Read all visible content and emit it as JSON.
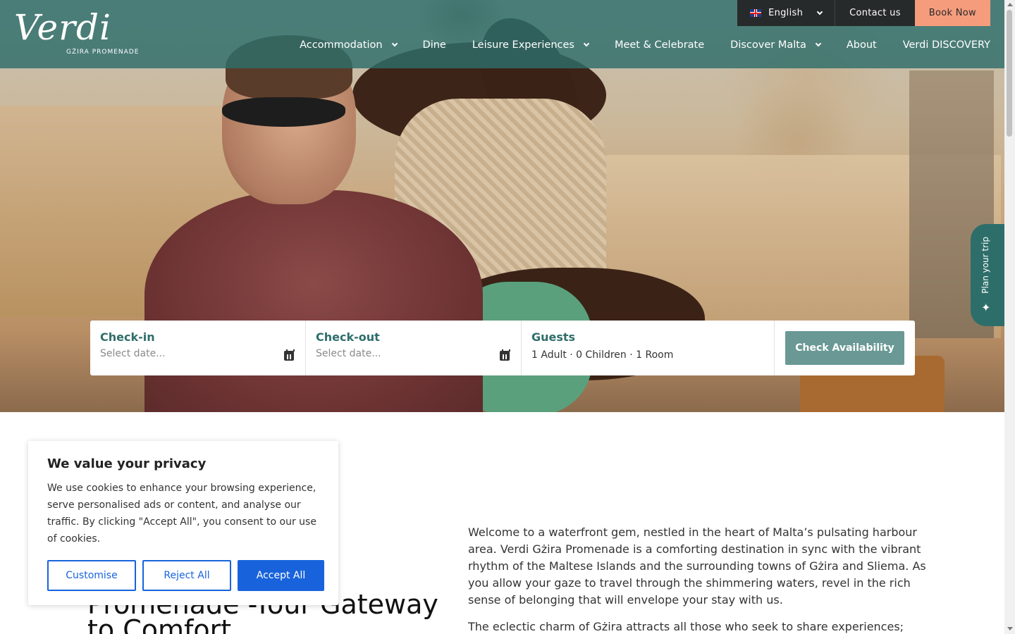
{
  "header": {
    "logo_text": "Verdi",
    "logo_subtitle": "GŻIRA PROMENADE",
    "topbar": {
      "language": "English",
      "contact": "Contact us",
      "book": "Book Now"
    },
    "nav": [
      {
        "label": "Accommodation",
        "has_dropdown": true
      },
      {
        "label": "Dine",
        "has_dropdown": false
      },
      {
        "label": "Leisure Experiences",
        "has_dropdown": true
      },
      {
        "label": "Meet & Celebrate",
        "has_dropdown": false
      },
      {
        "label": "Discover Malta",
        "has_dropdown": true
      },
      {
        "label": "About",
        "has_dropdown": false
      },
      {
        "label": "Verdi DISCOVERY",
        "has_dropdown": false
      }
    ]
  },
  "booking": {
    "checkin_label": "Check-in",
    "checkin_placeholder": "Select date...",
    "checkout_label": "Check-out",
    "checkout_placeholder": "Select date...",
    "guests_label": "Guests",
    "guests_value": "1 Adult · 0 Children · 1 Room",
    "button": "Check Availability"
  },
  "plan_trip": {
    "label": "Plan your trip",
    "icon": "sparkle-icon"
  },
  "content": {
    "heading": "Promenade -Your Gateway to Comfort",
    "paragraph1": "Welcome to a waterfront gem, nestled in the heart of Malta’s pulsating harbour area. Verdi Gżira Promenade is a comforting destination in sync with the vibrant rhythm of the Maltese Islands and the surrounding towns of Gżira and Sliema. As you allow your gaze to travel through the shimmering waters, revel in the rich sense of belonging that will envelope your stay with us.",
    "paragraph2": "The eclectic charm of Gżira attracts all those who seek to share experiences;"
  },
  "cookie": {
    "title": "We value your privacy",
    "text": "We use cookies to enhance your browsing experience, serve personalised ads or content, and analyse our traffic. By clicking \"Accept All\", you consent to our use of cookies.",
    "customise": "Customise",
    "reject": "Reject All",
    "accept": "Accept All"
  },
  "colors": {
    "brand_teal": "#2e6e6a",
    "book_now": "#f59c7c",
    "cookie_blue": "#1863dc",
    "check_button": "#6a9995"
  }
}
